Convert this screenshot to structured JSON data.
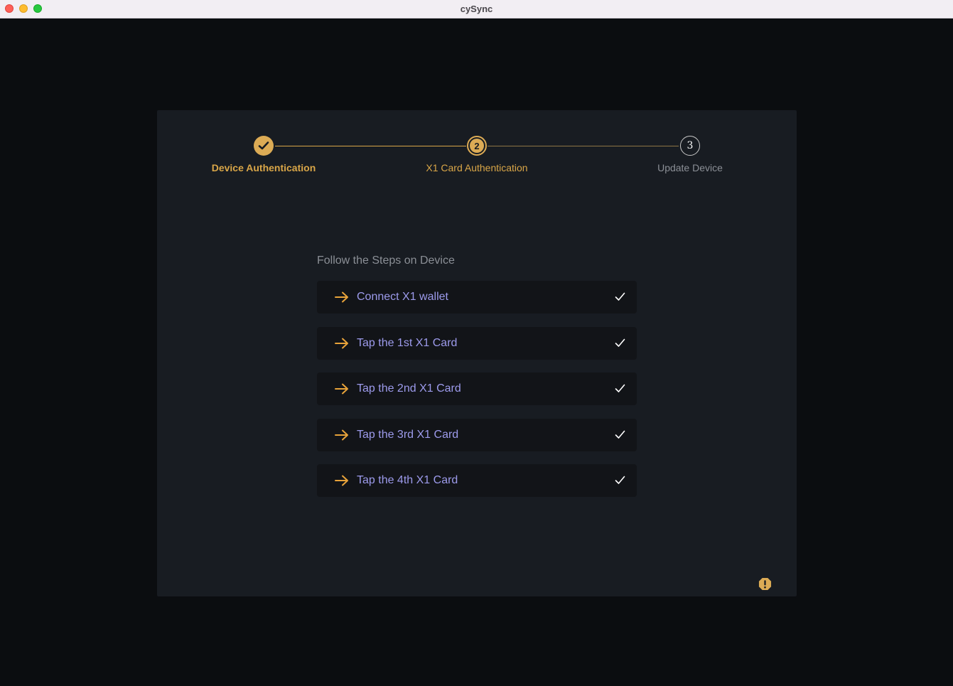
{
  "window": {
    "title": "cySync"
  },
  "stepper": {
    "steps": [
      {
        "label": "Device Authentication",
        "state": "done"
      },
      {
        "label": "X1 Card Authentication",
        "state": "active",
        "number": "2"
      },
      {
        "label": "Update Device",
        "state": "pending",
        "number": "3"
      }
    ]
  },
  "main": {
    "heading": "Follow the Steps on Device",
    "tasks": [
      {
        "label": "Connect X1 wallet",
        "status": "done"
      },
      {
        "label": "Tap the 1st X1 Card",
        "status": "done"
      },
      {
        "label": "Tap the 2nd X1 Card",
        "status": "done"
      },
      {
        "label": "Tap the 3rd X1 Card",
        "status": "done"
      },
      {
        "label": "Tap the 4th X1 Card",
        "status": "done"
      }
    ]
  },
  "icons": {
    "arrow": "arrow-right-icon",
    "check": "check-icon",
    "alert": "alert-octagon-icon"
  },
  "colors": {
    "accent": "#d9a648",
    "task_text": "#9d9bec",
    "card_bg": "#181c22",
    "task_bg": "#121418"
  }
}
